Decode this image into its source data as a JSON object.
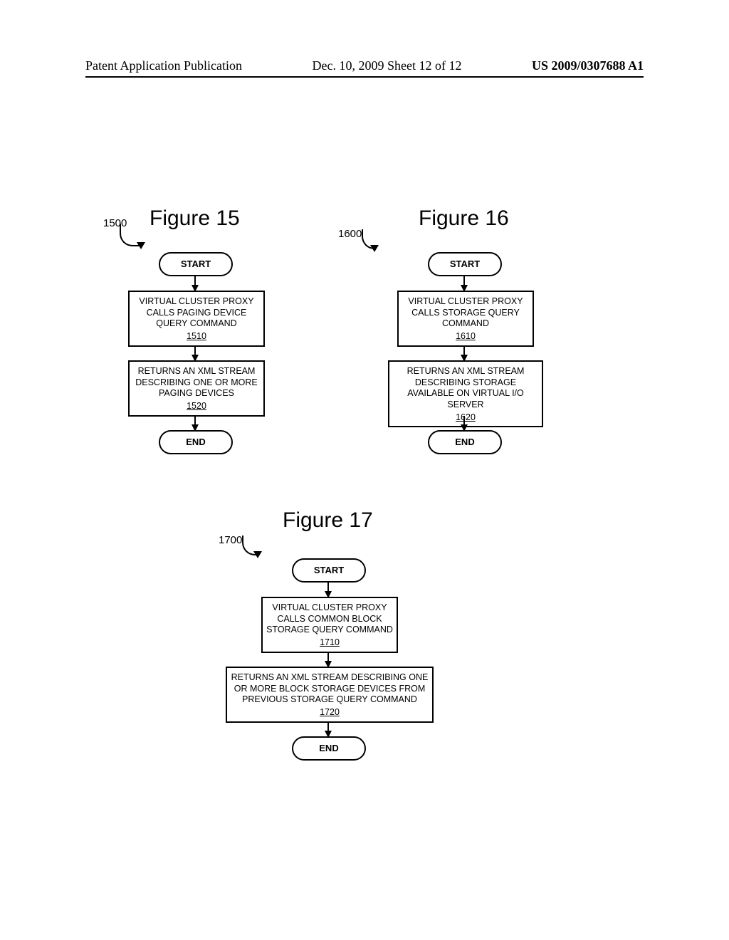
{
  "header": {
    "left": "Patent Application Publication",
    "mid": "Dec. 10, 2009  Sheet 12 of 12",
    "right": "US 2009/0307688 A1"
  },
  "start_label": "START",
  "end_label": "END",
  "fig15": {
    "title": "Figure 15",
    "ref": "1500",
    "step1": {
      "text": "VIRTUAL CLUSTER PROXY CALLS PAGING DEVICE QUERY COMMAND",
      "num": "1510"
    },
    "step2": {
      "text": "RETURNS AN XML STREAM DESCRIBING ONE OR MORE PAGING DEVICES",
      "num": "1520"
    }
  },
  "fig16": {
    "title": "Figure 16",
    "ref": "1600",
    "step1": {
      "text": "VIRTUAL CLUSTER PROXY CALLS STORAGE QUERY COMMAND",
      "num": "1610"
    },
    "step2": {
      "text": "RETURNS AN XML STREAM DESCRIBING STORAGE AVAILABLE ON VIRTUAL I/O SERVER",
      "num": "1620"
    }
  },
  "fig17": {
    "title": "Figure 17",
    "ref": "1700",
    "step1": {
      "text": "VIRTUAL CLUSTER PROXY CALLS COMMON BLOCK STORAGE QUERY COMMAND",
      "num": "1710"
    },
    "step2": {
      "text": "RETURNS AN XML STREAM DESCRIBING ONE OR MORE BLOCK STORAGE DEVICES FROM PREVIOUS STORAGE QUERY COMMAND",
      "num": "1720"
    }
  }
}
